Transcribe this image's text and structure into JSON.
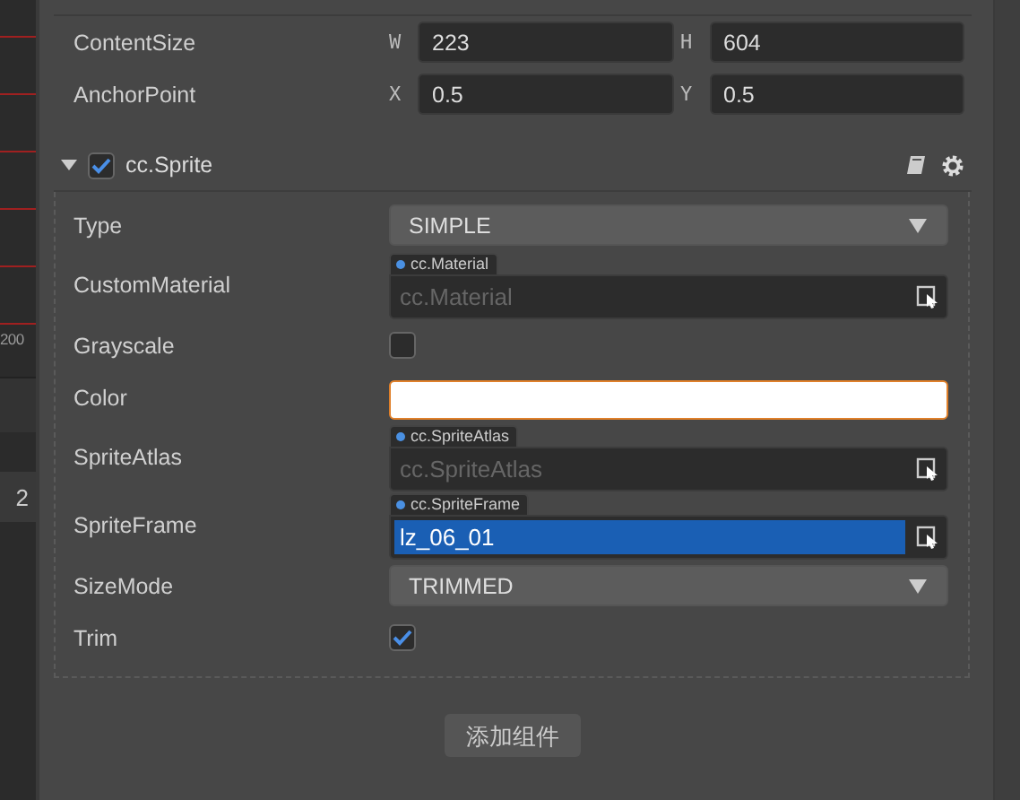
{
  "scene_strip": {
    "labels": [
      "200",
      "2"
    ]
  },
  "transform_rows": [
    {
      "label": "ContentSize",
      "fields": [
        {
          "axis": "W",
          "value": "223"
        },
        {
          "axis": "H",
          "value": "604"
        }
      ]
    },
    {
      "label": "AnchorPoint",
      "fields": [
        {
          "axis": "X",
          "value": "0.5"
        },
        {
          "axis": "Y",
          "value": "0.5"
        }
      ]
    }
  ],
  "component": {
    "name": "cc.Sprite",
    "enabled": true,
    "expanded": true
  },
  "properties": [
    {
      "kind": "select",
      "label": "Type",
      "value": "SIMPLE"
    },
    {
      "kind": "asset",
      "label": "CustomMaterial",
      "tag": "cc.Material",
      "placeholder": "cc.Material"
    },
    {
      "kind": "checkbox",
      "label": "Grayscale",
      "checked": false
    },
    {
      "kind": "color",
      "label": "Color",
      "color": "#ffffff"
    },
    {
      "kind": "asset",
      "label": "SpriteAtlas",
      "tag": "cc.SpriteAtlas",
      "placeholder": "cc.SpriteAtlas"
    },
    {
      "kind": "asset",
      "label": "SpriteFrame",
      "tag": "cc.SpriteFrame",
      "value": "lz_06_01"
    },
    {
      "kind": "select",
      "label": "SizeMode",
      "value": "TRIMMED"
    },
    {
      "kind": "checkbox",
      "label": "Trim",
      "checked": true
    }
  ],
  "add_button": "添加组件"
}
